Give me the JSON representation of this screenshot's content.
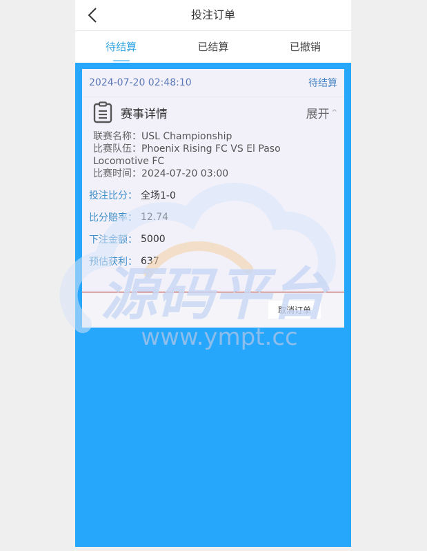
{
  "header": {
    "title": "投注订单"
  },
  "tabs": [
    {
      "label": "待结算",
      "active": true
    },
    {
      "label": "已结算",
      "active": false
    },
    {
      "label": "已撤销",
      "active": false
    }
  ],
  "order": {
    "datetime": "2024-07-20 02:48:10",
    "status": "待结算",
    "section_title": "赛事详情",
    "expand_label": "展开",
    "details": [
      {
        "label": "联赛名称：",
        "value": "USL Championship"
      },
      {
        "label": "比赛队伍：",
        "value": "Phoenix Rising FC VS El Paso Locomotive FC"
      },
      {
        "label": "比赛时间：",
        "value": "2024-07-20 03:00"
      }
    ],
    "bet": [
      {
        "label": "投注比分：",
        "value": "全场1-0"
      },
      {
        "label": "比分赔率：",
        "value": "12.74"
      },
      {
        "label": "下注金额：",
        "value": "5000"
      },
      {
        "label": "预估获利：",
        "value": "637"
      }
    ],
    "cancel_label": "取消订单"
  },
  "watermark": {
    "text": "源码平台",
    "url": "www.ympt.cc"
  },
  "colors": {
    "accent": "#2ea3e0",
    "content_bg": "#27a7fc",
    "divider": "#a31515"
  }
}
